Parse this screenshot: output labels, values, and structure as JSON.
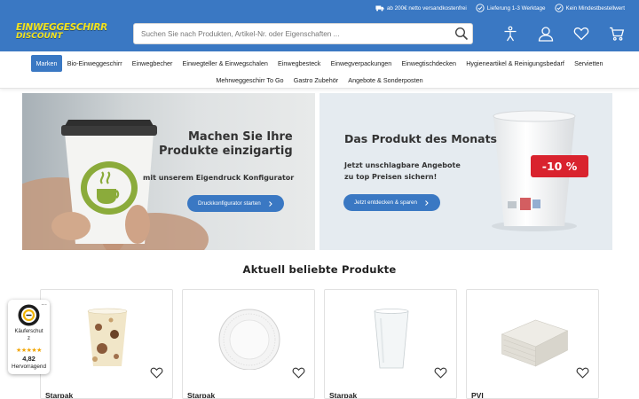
{
  "header": {
    "logo_line1": "EINWEGGESCHIRR",
    "logo_line2": "DISCOUNT",
    "trust": [
      {
        "label": "ab 200€ netto versandkostenfrei",
        "icon": "truck-icon"
      },
      {
        "label": "Lieferung 1-3 Werktage",
        "icon": "check-circle-icon"
      },
      {
        "label": "Kein Mindestbestellwert",
        "icon": "check-circle-icon"
      }
    ],
    "search_placeholder": "Suchen Sie nach Produkten, Artikel-Nr. oder Eigenschaften ...",
    "icons": [
      "accessibility-icon",
      "user-icon",
      "heart-icon",
      "cart-icon"
    ]
  },
  "nav": {
    "row1": [
      "Marken",
      "Bio-Einweggeschirr",
      "Einwegbecher",
      "Einwegteller & Einwegschalen",
      "Einwegbesteck",
      "Einwegverpackungen",
      "Einwegtischdecken",
      "Hygieneartikel & Reinigungsbedarf",
      "Servietten"
    ],
    "row2": [
      "Mehrweggeschirr To Go",
      "Gastro Zubehör",
      "Angebote & Sonderposten"
    ],
    "active": "Marken"
  },
  "banner_left": {
    "headline_1": "Machen Sie Ihre",
    "headline_2": "Produkte einzigartig",
    "subline": "mit unserem Eigendruck Konfigurator",
    "button": "Druckkonfigurator starten"
  },
  "banner_right": {
    "headline": "Das Produkt des Monats",
    "sub_1": "Jetzt unschlagbare Angebote",
    "sub_2": "zu top Preisen sichern!",
    "button": "Jetzt entdecken & sparen",
    "discount": "-10 %"
  },
  "section_title": "Aktuell beliebte Produkte",
  "products": [
    {
      "brand": "Starpak",
      "image": "paper-cup-coffee-pattern"
    },
    {
      "brand": "Starpak",
      "image": "paper-plate-white"
    },
    {
      "brand": "Starpak",
      "image": "plastic-cup-clear"
    },
    {
      "brand": "PVI",
      "image": "napkin-stack"
    }
  ],
  "trust_badge": {
    "label_1": "Käuferschut",
    "label_2": "z",
    "stars": "★★★★★",
    "score": "4,82",
    "grade": "Hervorragend",
    "more": "..."
  },
  "colors": {
    "primary": "#3a78c3",
    "logo_yellow": "#f2e21f",
    "discount_red": "#d9232e",
    "star": "#f2a500"
  }
}
